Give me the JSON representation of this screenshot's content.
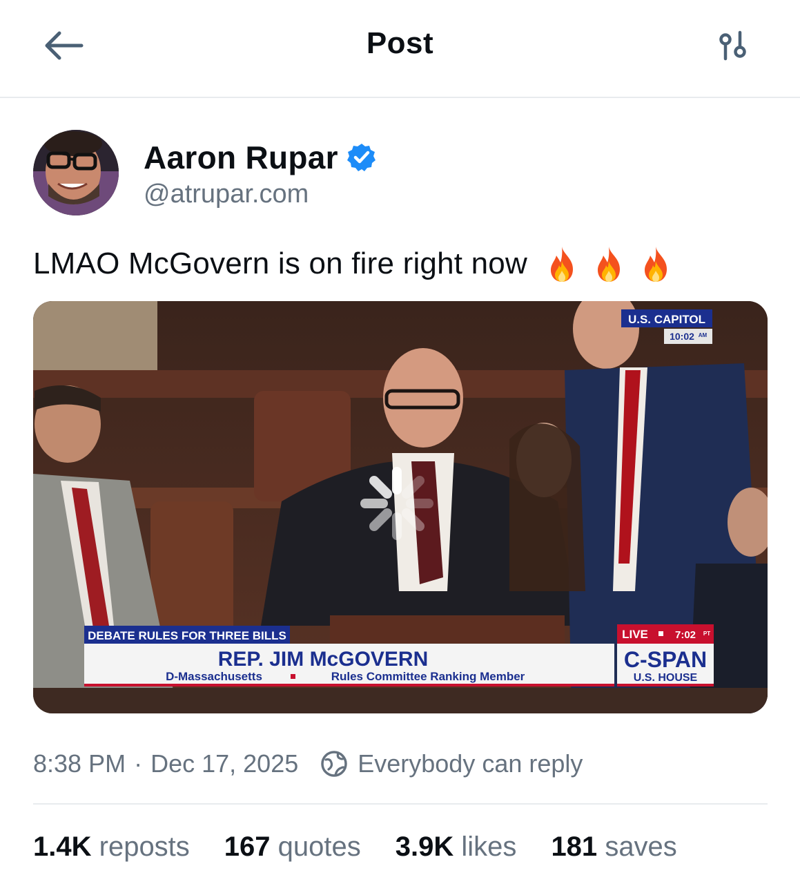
{
  "header": {
    "title": "Post",
    "back_icon": "arrow-left-icon",
    "options_icon": "sliders-icon"
  },
  "author": {
    "display_name": "Aaron Rupar",
    "handle": "@atrupar.com",
    "verified": true,
    "verified_color": "#1d8cf8"
  },
  "post": {
    "text": "LMAO McGovern is on fire right now",
    "emoji": [
      "fire-emoji",
      "fire-emoji",
      "fire-emoji"
    ]
  },
  "video": {
    "loading_icon": "spinner-icon",
    "overlay": {
      "bug_top": "U.S. CAPITOL",
      "bug_time": "10:02",
      "bug_time_suffix": "AM",
      "lower_third_tag": "DEBATE RULES FOR THREE BILLS",
      "speaker_name": "REP. JIM McGOVERN",
      "speaker_party": "D-Massachusetts",
      "speaker_role": "Rules Committee Ranking Member",
      "live_label": "LIVE",
      "live_time": "7:02",
      "live_time_suffix": "PT",
      "network": "C-SPAN",
      "network_sub": "U.S. HOUSE"
    }
  },
  "meta": {
    "time": "8:38 PM",
    "separator": "·",
    "date": "Dec 17, 2025",
    "reply_setting": "Everybody can reply",
    "reply_icon": "globe-icon"
  },
  "stats": [
    {
      "count": "1.4K",
      "label": "reposts"
    },
    {
      "count": "167",
      "label": "quotes"
    },
    {
      "count": "3.9K",
      "label": "likes"
    },
    {
      "count": "181",
      "label": "saves"
    }
  ],
  "colors": {
    "text_primary": "#0b0f14",
    "text_secondary": "#66727f",
    "icon": "#4a6075",
    "divider": "#e8ebee",
    "cspan_blue": "#1b2f8f",
    "cspan_red": "#c8102e"
  }
}
